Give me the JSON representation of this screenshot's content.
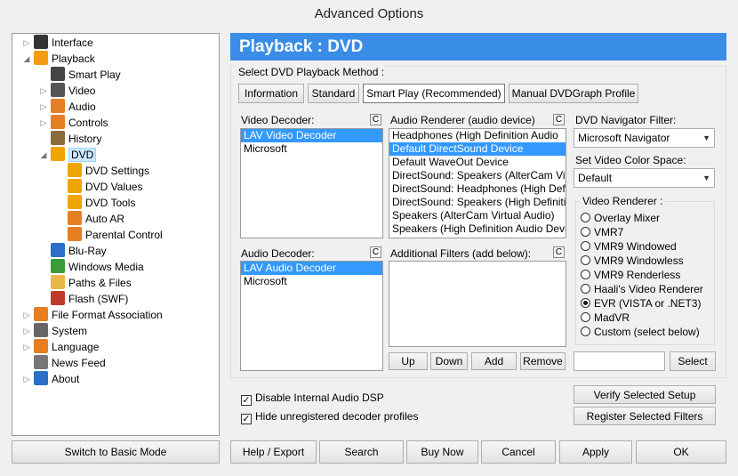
{
  "window": {
    "title": "Advanced Options"
  },
  "tree": [
    {
      "label": "Interface",
      "level": 0,
      "arrow": "▷",
      "icon": "monitor-icon",
      "color": "#333"
    },
    {
      "label": "Playback",
      "level": 0,
      "arrow": "◢",
      "icon": "play-icon",
      "color": "#f39c12"
    },
    {
      "label": "Smart Play",
      "level": 1,
      "arrow": "",
      "icon": "graduation-cap-icon",
      "color": "#444"
    },
    {
      "label": "Video",
      "level": 1,
      "arrow": "▷",
      "icon": "film-clapper-icon",
      "color": "#555"
    },
    {
      "label": "Audio",
      "level": 1,
      "arrow": "▷",
      "icon": "music-note-icon",
      "color": "#e67e22"
    },
    {
      "label": "Controls",
      "level": 1,
      "arrow": "▷",
      "icon": "slider-icon",
      "color": "#e67e22"
    },
    {
      "label": "History",
      "level": 1,
      "arrow": "",
      "icon": "history-icon",
      "color": "#8e6b3e"
    },
    {
      "label": "DVD",
      "level": 1,
      "arrow": "◢",
      "icon": "dvd-icon",
      "color": "#f0a500",
      "selected": true
    },
    {
      "label": "DVD Settings",
      "level": 2,
      "arrow": "",
      "icon": "dvd-settings-icon",
      "color": "#f0a500"
    },
    {
      "label": "DVD Values",
      "level": 2,
      "arrow": "",
      "icon": "dvd-values-icon",
      "color": "#f0a500"
    },
    {
      "label": "DVD Tools",
      "level": 2,
      "arrow": "",
      "icon": "dvd-tools-icon",
      "color": "#f0a500"
    },
    {
      "label": "Auto AR",
      "level": 2,
      "arrow": "",
      "icon": "auto-ar-icon",
      "color": "#e67e22"
    },
    {
      "label": "Parental Control",
      "level": 2,
      "arrow": "",
      "icon": "parental-control-icon",
      "color": "#e67e22"
    },
    {
      "label": "Blu-Ray",
      "level": 1,
      "arrow": "",
      "icon": "bluray-icon",
      "color": "#2a6fc9"
    },
    {
      "label": "Windows Media",
      "level": 1,
      "arrow": "",
      "icon": "windows-media-icon",
      "color": "#3a9b3a"
    },
    {
      "label": "Paths & Files",
      "level": 1,
      "arrow": "",
      "icon": "folder-icon",
      "color": "#e8b84a"
    },
    {
      "label": "Flash (SWF)",
      "level": 1,
      "arrow": "",
      "icon": "flash-icon",
      "color": "#c0392b"
    },
    {
      "label": "File Format Association",
      "level": 0,
      "arrow": "▷",
      "icon": "file-format-icon",
      "color": "#e67e22"
    },
    {
      "label": "System",
      "level": 0,
      "arrow": "▷",
      "icon": "gear-icon",
      "color": "#666"
    },
    {
      "label": "Language",
      "level": 0,
      "arrow": "▷",
      "icon": "language-icon",
      "color": "#e67e22"
    },
    {
      "label": "News Feed",
      "level": 0,
      "arrow": "",
      "icon": "news-icon",
      "color": "#777"
    },
    {
      "label": "About",
      "level": 0,
      "arrow": "▷",
      "icon": "info-icon",
      "color": "#2a6fc9"
    }
  ],
  "panel": {
    "title": "Playback : DVD",
    "method_group_label": "Select DVD Playback Method :",
    "method_tabs": [
      "Information",
      "Standard",
      "Smart Play (Recommended)",
      "Manual DVDGraph Profile"
    ],
    "video_decoder": {
      "label": "Video Decoder:",
      "clear": "C",
      "items": [
        "LAV Video Decoder",
        "Microsoft"
      ]
    },
    "audio_renderer": {
      "label": "Audio Renderer (audio device)",
      "clear": "C",
      "items": [
        "Headphones (High Definition Audio",
        "Default DirectSound Device",
        "Default WaveOut Device",
        "DirectSound: Speakers (AlterCam Virt",
        "DirectSound: Headphones (High Defin",
        "DirectSound: Speakers (High Definitio",
        "Speakers (AlterCam Virtual Audio)",
        "Speakers (High Definition Audio Devi"
      ]
    },
    "audio_decoder": {
      "label": "Audio Decoder:",
      "clear": "C",
      "items": [
        "LAV Audio Decoder",
        "Microsoft"
      ]
    },
    "additional_filters": {
      "label": "Additional Filters (add below):",
      "clear": "C",
      "items": []
    },
    "filter_buttons": [
      "Up",
      "Down",
      "Add",
      "Remove"
    ],
    "dvd_navigator": {
      "label": "DVD Navigator Filter:",
      "value": "Microsoft Navigator"
    },
    "color_space": {
      "label": "Set Video Color Space:",
      "value": "Default"
    },
    "video_renderer": {
      "label": "Video Renderer :",
      "options": [
        "Overlay Mixer",
        "VMR7",
        "VMR9 Windowed",
        "VMR9 Windowless",
        "VMR9 Renderless",
        "Haali's Video Renderer",
        "EVR (VISTA or .NET3)",
        "MadVR",
        "Custom (select below)"
      ],
      "selected": 6
    },
    "select_button": "Select",
    "checks": [
      {
        "label": "Disable Internal Audio DSP",
        "checked": true
      },
      {
        "label": "Hide unregistered decoder profiles",
        "checked": true
      }
    ],
    "verify_button": "Verify Selected Setup",
    "register_button": "Register Selected Filters",
    "check_mark": "✓"
  },
  "footer": {
    "basic_mode": "Switch to Basic Mode",
    "help": "Help / Export",
    "search": "Search",
    "buy": "Buy Now",
    "cancel": "Cancel",
    "apply": "Apply",
    "ok": "OK"
  }
}
